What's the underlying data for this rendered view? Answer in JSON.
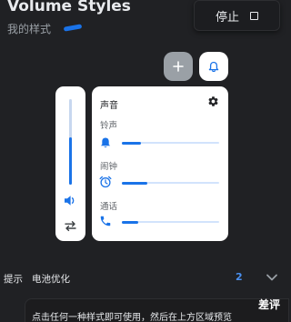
{
  "header": {
    "title": "Volume Styles",
    "subtitle": "我的样式"
  },
  "stop_button": {
    "label": "停止",
    "icon": "stop-square-icon"
  },
  "actions": {
    "add_icon": "plus-icon",
    "notification_icon": "bell-icon"
  },
  "master_slider": {
    "level": 0.55,
    "icon": "speaker-icon",
    "toggle_icon": "swap-arrows-icon"
  },
  "sound_card": {
    "title": "声音",
    "settings_icon": "gear-icon",
    "rows": [
      {
        "label": "铃声",
        "icon": "bell-icon",
        "level": 0.2
      },
      {
        "label": "闹钟",
        "icon": "alarm-clock-icon",
        "level": 0.26
      },
      {
        "label": "通话",
        "icon": "phone-icon",
        "level": 0.17
      }
    ]
  },
  "footer": {
    "hint_label": "提示",
    "battery_label": "电池优化",
    "count": "2",
    "chevron_icon": "chevron-down-icon"
  },
  "toast": {
    "message": "点击任何一种样式即可使用，然后在上方区域预览",
    "action": "差评"
  },
  "colors": {
    "background": "#202124",
    "accent": "#1a73e8",
    "panel": "#ffffff"
  }
}
